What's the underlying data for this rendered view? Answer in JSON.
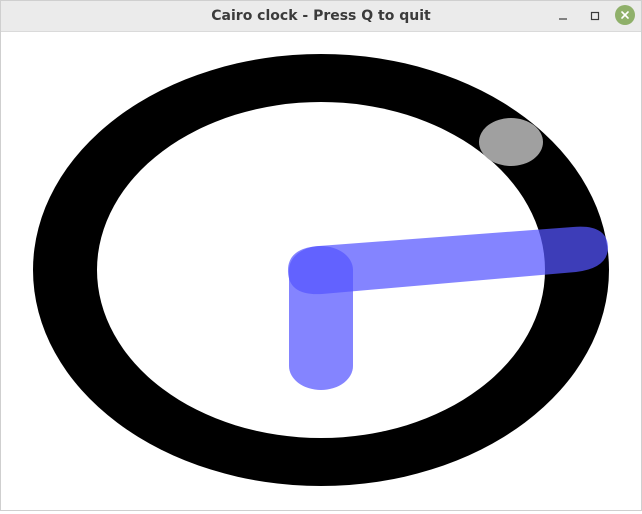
{
  "window": {
    "title": "Cairo clock - Press Q to quit"
  },
  "controls": {
    "minimize_icon": "minimize-icon",
    "maximize_icon": "maximize-icon",
    "close_icon": "close-icon",
    "close_color": "#8fb06a"
  },
  "clock": {
    "ring_color": "#000000",
    "face_color": "#ffffff",
    "hand_color": "#5555ff",
    "second_marker_color": "#a0a0a0"
  }
}
